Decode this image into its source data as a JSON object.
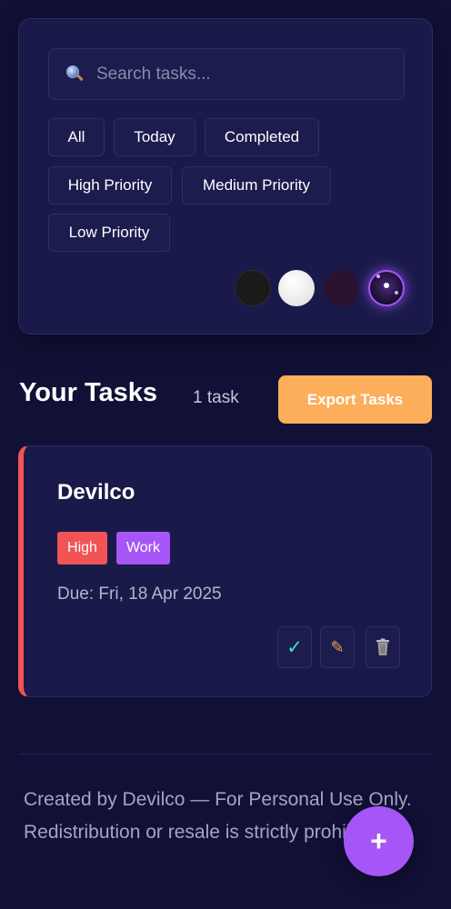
{
  "search": {
    "placeholder": "Search tasks..."
  },
  "filters": [
    {
      "label": "All"
    },
    {
      "label": "Today"
    },
    {
      "label": "Completed"
    },
    {
      "label": "High Priority"
    },
    {
      "label": "Medium Priority"
    },
    {
      "label": "Low Priority"
    }
  ],
  "themes": [
    {
      "name": "dark",
      "color": "#1a1a1a"
    },
    {
      "name": "light",
      "color": "#f2f2f2"
    },
    {
      "name": "wine",
      "color": "#2a1230"
    },
    {
      "name": "galaxy",
      "color": "#170c2c",
      "selected": true
    }
  ],
  "tasks_header": {
    "title": "Your Tasks",
    "count": "1 task",
    "export_label": "Export Tasks"
  },
  "tasks": [
    {
      "title": "Devilco",
      "priority": "High",
      "category": "Work",
      "due": "Due: Fri, 18 Apr 2025",
      "priority_color": "#f05454",
      "category_color": "#a656f7"
    }
  ],
  "task_actions": {
    "complete_icon": "checkmark-icon",
    "edit_icon": "pencil-icon",
    "delete_icon": "trash-icon"
  },
  "footer": {
    "line1": "Created by Devilco — For Personal Use Only.",
    "line2": "Redistribution or resale is strictly prohibited."
  },
  "fab": {
    "label": "+"
  },
  "colors": {
    "background": "#111036",
    "card": "#1a1a4a",
    "accent": "#a656f7",
    "export": "#fdae5a",
    "high": "#f05454"
  }
}
